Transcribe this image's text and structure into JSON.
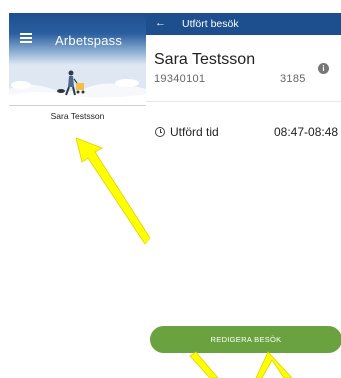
{
  "left_screen": {
    "title": "Arbetspass",
    "menu_icon": "menu-icon",
    "patient_name": "Sara Testsson"
  },
  "right_screen": {
    "header_title": "Utfört besök",
    "back_icon": "arrow-left-icon",
    "patient": {
      "name": "Sara Testsson",
      "id": "19340101",
      "number": "3185",
      "info_icon": "info-icon"
    },
    "time": {
      "label": "Utförd tid",
      "value": "08:47-08:48",
      "icon": "clock-icon"
    },
    "edit_button_label": "REDIGERA BESÖK"
  },
  "colors": {
    "header_blue": "#1d4f8f",
    "button_green": "#6aa240",
    "annotation_yellow": "#ffff00"
  }
}
